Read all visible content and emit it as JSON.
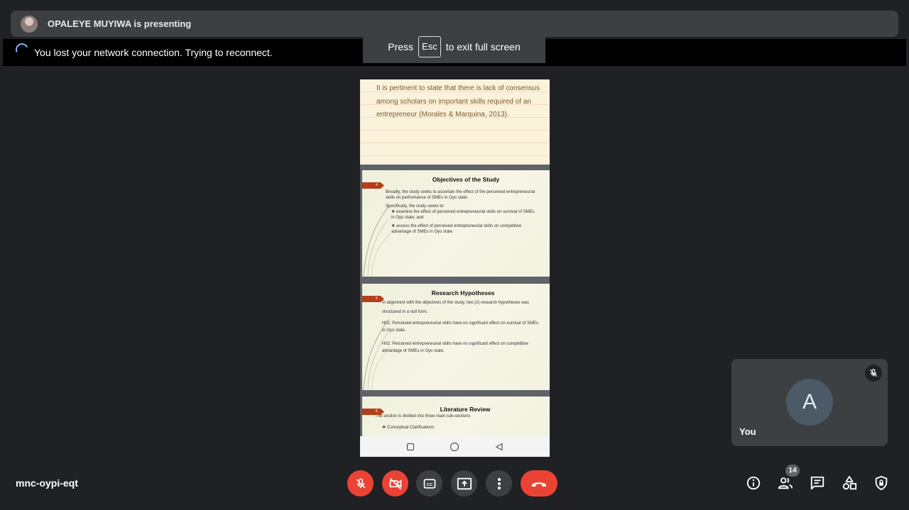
{
  "presenter": {
    "name_text": "OPALEYE MUYIWA is presenting"
  },
  "connection": {
    "message": "You lost your network connection. Trying to reconnect."
  },
  "fullscreen_hint": {
    "press": "Press",
    "key": "Esc",
    "suffix": "to exit full screen"
  },
  "shared_screen": {
    "slide1": {
      "text": "It is pertinent to state that there is lack of consensus among scholars on important skills required of an entrepreneur (Morales & Marquina, 2013)."
    },
    "slide2": {
      "number": "4",
      "title": "Objectives of the Study",
      "p1": "Broadly, the study seeks to ascertain the effect of the perceived entrepreneurial skills on performance of SMEs in Oyo state.",
      "p2": "Specifically, the study seeks to:",
      "b1": "examine the effect of perceived entrepreneurial skills on survival of SMEs in Oyo state; and",
      "b2": "assess the effect of perceived entrepreneurial skills on competitive advantage of SMEs in Oyo state"
    },
    "slide3": {
      "number": "5",
      "title": "Research Hypotheses",
      "p1": "In alignment with the objectives of the study, two (2) research hypotheses was structured in a null form.",
      "h1": "H01: Perceived entrepreneurial skills have no significant effect on survival of SMEs in Oyo state.",
      "h2": "H02: Perceived entrepreneurial skills have no significant effect on competitive advantage of SMEs in Oyo state."
    },
    "slide4": {
      "number": "6",
      "title": "Literature Review",
      "p1": "The section is divided into three main sub-sections",
      "b1": "Conceptual Clarifications"
    }
  },
  "self_tile": {
    "initial": "A",
    "name": "You"
  },
  "meeting": {
    "code": "mnc-oypi-eqt"
  },
  "participants": {
    "count": "14"
  },
  "colors": {
    "end_call": "#ea4335",
    "accent": "#8ab4f8",
    "control_grey": "#3c4043"
  },
  "icons": [
    "mic-off-icon",
    "videocam-off-icon",
    "closed-caption-icon",
    "present-screen-icon",
    "more-vert-icon",
    "call-end-icon",
    "info-icon",
    "people-icon",
    "chat-icon",
    "activities-icon",
    "host-controls-icon"
  ]
}
